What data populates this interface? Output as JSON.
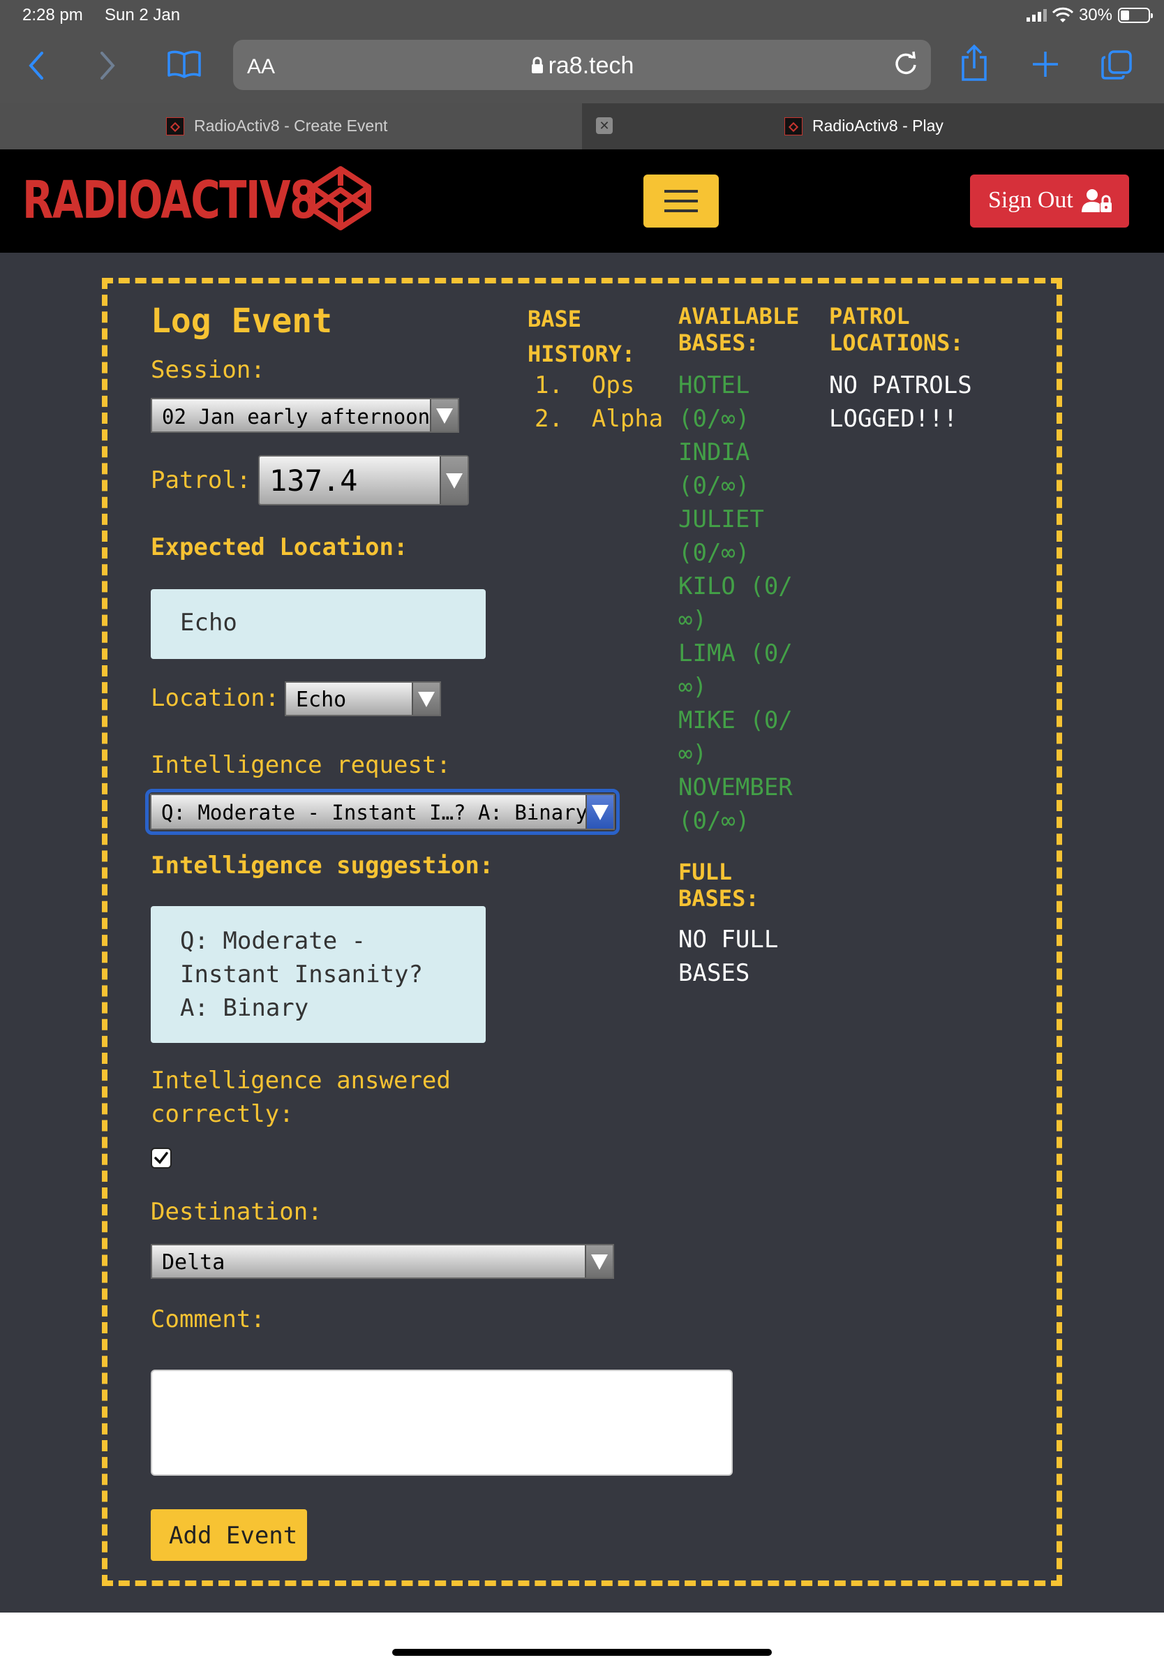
{
  "status": {
    "time": "2:28 pm",
    "date": "Sun 2 Jan",
    "battery": "30%"
  },
  "browser": {
    "aa_label": "AA",
    "url": "ra8.tech",
    "tabs": [
      {
        "title": "RadioActiv8 - Create Event",
        "active": false
      },
      {
        "title": "RadioActiv8 - Play",
        "active": true
      }
    ]
  },
  "navbar": {
    "brand": "RADIOACTIV8",
    "signout_label": "Sign Out"
  },
  "form": {
    "heading": "Log Event",
    "session_label": "Session:",
    "session_value": "02 Jan early afternoon",
    "patrol_label": "Patrol:",
    "patrol_value": "137.4",
    "expected_location_label": "Expected Location:",
    "expected_location_value": "Echo",
    "location_label": "Location:",
    "location_value": "Echo",
    "intel_request_label": "Intelligence request:",
    "intel_request_value": "Q: Moderate - Instant I…? A: Binary",
    "intel_suggestion_label": "Intelligence suggestion:",
    "intel_suggestion_lines": [
      "Q: Moderate -",
      "Instant Insanity?",
      "A: Binary"
    ],
    "intel_answered_label_lines": [
      "Intelligence answered",
      "correctly:"
    ],
    "intel_answered_checked": true,
    "destination_label": "Destination:",
    "destination_value": "Delta",
    "comment_label": "Comment:",
    "comment_value": "",
    "submit_label": "Add Event"
  },
  "base_history": {
    "title_lines": [
      "BASE",
      "HISTORY:"
    ],
    "items": [
      {
        "num": "1.",
        "name": "Ops"
      },
      {
        "num": "2.",
        "name": "Alpha"
      }
    ]
  },
  "available_bases": {
    "title_lines": [
      "AVAILABLE",
      "BASES:"
    ],
    "items": [
      {
        "line1": "HOTEL",
        "line2": "(0/∞)"
      },
      {
        "line1": "INDIA",
        "line2": "(0/∞)"
      },
      {
        "line1": "JULIET",
        "line2": "(0/∞)"
      },
      {
        "line1": "KILO (0/",
        "line2": "∞)"
      },
      {
        "line1": "LIMA (0/",
        "line2": "∞)"
      },
      {
        "line1": "MIKE (0/",
        "line2": "∞)"
      },
      {
        "line1": "NOVEMBER",
        "line2": "(0/∞)"
      }
    ]
  },
  "full_bases": {
    "title_lines": [
      "FULL",
      "BASES:"
    ],
    "empty_lines": [
      "NO FULL",
      "BASES"
    ]
  },
  "patrol_locations": {
    "title_lines": [
      "PATROL",
      "LOCATIONS:"
    ],
    "empty_lines": [
      "NO PATROLS",
      "LOGGED!!!"
    ]
  },
  "colors": {
    "accent": "#f7c333",
    "brand_red": "#d0312d",
    "signout_red": "#d6303a",
    "panel_bg": "#363840",
    "available_green": "#43a047",
    "info_box": "#d7ecf0"
  }
}
